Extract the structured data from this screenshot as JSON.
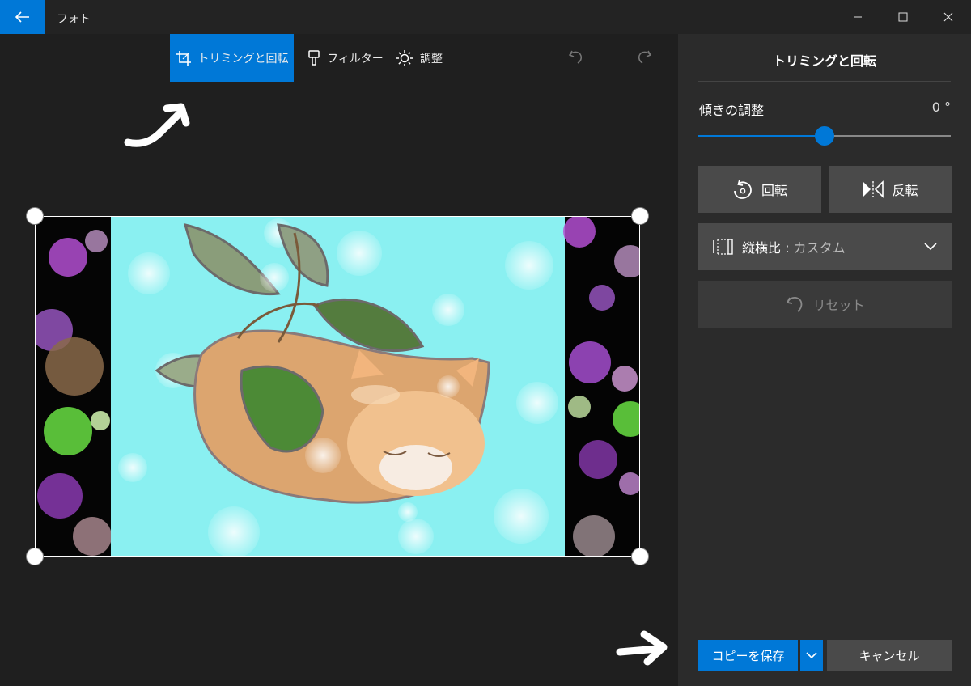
{
  "window": {
    "title": "フォト"
  },
  "toolbar": {
    "tabs": [
      {
        "label": "トリミングと回転",
        "icon": "crop-icon",
        "active": true
      },
      {
        "label": "フィルター",
        "icon": "brush-icon",
        "active": false
      },
      {
        "label": "調整",
        "icon": "sun-icon",
        "active": false
      }
    ],
    "undo_icon": "undo-icon",
    "redo_icon": "redo-icon"
  },
  "panel": {
    "title": "トリミングと回転",
    "straighten": {
      "label": "傾きの調整",
      "value": "0 °",
      "level": 0.5
    },
    "rotate_label": "回転",
    "flip_label": "反転",
    "aspect": {
      "prefix": "縦横比 : ",
      "value": "カスタム"
    },
    "reset_label": "リセット"
  },
  "footer": {
    "save_label": "コピーを保存",
    "cancel_label": "キャンセル"
  },
  "colors": {
    "accent": "#0078d7",
    "panel_bg": "#2b2b2b",
    "canvas_bg": "#1f1f1f",
    "button_bg": "#4a4a4a"
  }
}
